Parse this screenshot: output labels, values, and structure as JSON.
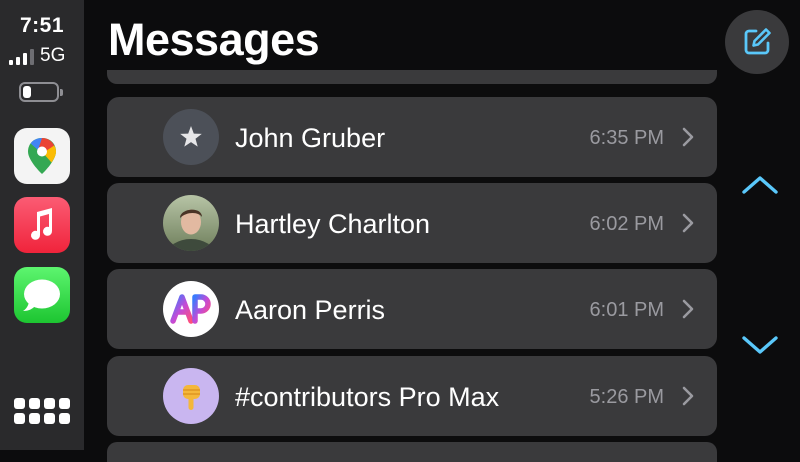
{
  "status": {
    "time": "7:51",
    "network": "5G",
    "signal_bars_active": 3,
    "signal_bars_total": 4,
    "battery_level": 0.25
  },
  "dock": {
    "apps": [
      {
        "name": "Google Maps",
        "icon": "maps-icon"
      },
      {
        "name": "Music",
        "icon": "music-icon"
      },
      {
        "name": "Messages",
        "icon": "messages-icon"
      }
    ],
    "app_grid_icon": "grid-icon"
  },
  "header": {
    "title": "Messages",
    "compose_icon": "compose-icon"
  },
  "conversations": [
    {
      "name": "John Gruber",
      "time": "6:35 PM",
      "avatar": "star-icon"
    },
    {
      "name": "Hartley Charlton",
      "time": "6:02 PM",
      "avatar": "photo"
    },
    {
      "name": "Aaron Perris",
      "time": "6:01 PM",
      "avatar": "ap-logo"
    },
    {
      "name": "#contributors Pro Max",
      "time": "5:26 PM",
      "avatar": "pointing-hand-emoji"
    }
  ],
  "colors": {
    "accent": "#5ac8fa",
    "row_background": "#3a3a3c",
    "secondary_text": "#9a9aa0"
  }
}
